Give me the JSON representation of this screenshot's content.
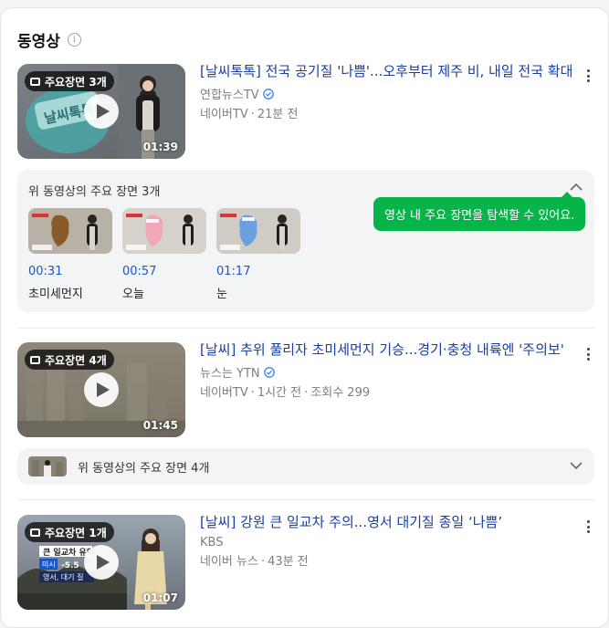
{
  "section": {
    "title": "동영상",
    "info_icon": "info-icon"
  },
  "videos": [
    {
      "badge": "주요장면 3개",
      "duration": "01:39",
      "title": "[날씨톡톡] 전국 공기질 '나쁨'...오후부터 제주 비, 내일 전국 확대",
      "source": "연합뉴스TV",
      "verified": true,
      "meta": [
        "네이버TV",
        "21분 전"
      ],
      "thumb_text": "날씨톡톡"
    },
    {
      "badge": "주요장면 4개",
      "duration": "01:45",
      "title": "[날씨] 추위 풀리자 초미세먼지 기승...경기·충청 내륙엔 '주의보'",
      "source": "뉴스는 YTN",
      "verified": true,
      "meta": [
        "네이버TV",
        "1시간 전",
        "조회수 299"
      ]
    },
    {
      "badge": "주요장면 1개",
      "duration": "01:07",
      "title": "[날씨] 강원 큰 일교차 주의...영서 대기질 종일 ‘나쁨’",
      "source": "KBS",
      "verified": false,
      "meta": [
        "네이버 뉴스",
        "43분 전"
      ],
      "thumb_text": {
        "line1": "큰 일교차 유의",
        "line2": "미시",
        "line3": "-5.5",
        "line4": "영서, 대기 질"
      }
    }
  ],
  "scenes_expanded": {
    "title": "위 동영상의 주요 장면 3개",
    "tooltip": "영상 내 주요 장면을 탐색할 수 있어요.",
    "items": [
      {
        "time": "00:31",
        "label": "초미세먼지",
        "map_color": "#8b5a2b"
      },
      {
        "time": "00:57",
        "label": "오늘",
        "map_color": "#f0a8b8"
      },
      {
        "time": "01:17",
        "label": "눈",
        "map_color": "#6aa0e0"
      }
    ]
  },
  "scenes_collapsed": {
    "title": "위 동영상의 주요 장면 4개"
  },
  "colors": {
    "link": "#1a3ea1",
    "time": "#1a56c4",
    "tooltip": "#07b44a",
    "verified": "#3b82f6"
  }
}
